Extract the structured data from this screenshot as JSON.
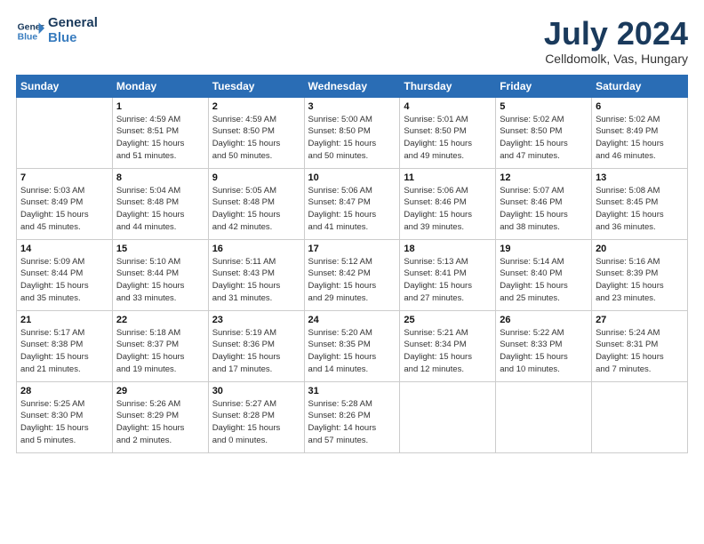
{
  "header": {
    "logo_line1": "General",
    "logo_line2": "Blue",
    "month": "July 2024",
    "location": "Celldomolk, Vas, Hungary"
  },
  "weekdays": [
    "Sunday",
    "Monday",
    "Tuesday",
    "Wednesday",
    "Thursday",
    "Friday",
    "Saturday"
  ],
  "weeks": [
    [
      {
        "day": "",
        "info": ""
      },
      {
        "day": "1",
        "info": "Sunrise: 4:59 AM\nSunset: 8:51 PM\nDaylight: 15 hours\nand 51 minutes."
      },
      {
        "day": "2",
        "info": "Sunrise: 4:59 AM\nSunset: 8:50 PM\nDaylight: 15 hours\nand 50 minutes."
      },
      {
        "day": "3",
        "info": "Sunrise: 5:00 AM\nSunset: 8:50 PM\nDaylight: 15 hours\nand 50 minutes."
      },
      {
        "day": "4",
        "info": "Sunrise: 5:01 AM\nSunset: 8:50 PM\nDaylight: 15 hours\nand 49 minutes."
      },
      {
        "day": "5",
        "info": "Sunrise: 5:02 AM\nSunset: 8:50 PM\nDaylight: 15 hours\nand 47 minutes."
      },
      {
        "day": "6",
        "info": "Sunrise: 5:02 AM\nSunset: 8:49 PM\nDaylight: 15 hours\nand 46 minutes."
      }
    ],
    [
      {
        "day": "7",
        "info": "Sunrise: 5:03 AM\nSunset: 8:49 PM\nDaylight: 15 hours\nand 45 minutes."
      },
      {
        "day": "8",
        "info": "Sunrise: 5:04 AM\nSunset: 8:48 PM\nDaylight: 15 hours\nand 44 minutes."
      },
      {
        "day": "9",
        "info": "Sunrise: 5:05 AM\nSunset: 8:48 PM\nDaylight: 15 hours\nand 42 minutes."
      },
      {
        "day": "10",
        "info": "Sunrise: 5:06 AM\nSunset: 8:47 PM\nDaylight: 15 hours\nand 41 minutes."
      },
      {
        "day": "11",
        "info": "Sunrise: 5:06 AM\nSunset: 8:46 PM\nDaylight: 15 hours\nand 39 minutes."
      },
      {
        "day": "12",
        "info": "Sunrise: 5:07 AM\nSunset: 8:46 PM\nDaylight: 15 hours\nand 38 minutes."
      },
      {
        "day": "13",
        "info": "Sunrise: 5:08 AM\nSunset: 8:45 PM\nDaylight: 15 hours\nand 36 minutes."
      }
    ],
    [
      {
        "day": "14",
        "info": "Sunrise: 5:09 AM\nSunset: 8:44 PM\nDaylight: 15 hours\nand 35 minutes."
      },
      {
        "day": "15",
        "info": "Sunrise: 5:10 AM\nSunset: 8:44 PM\nDaylight: 15 hours\nand 33 minutes."
      },
      {
        "day": "16",
        "info": "Sunrise: 5:11 AM\nSunset: 8:43 PM\nDaylight: 15 hours\nand 31 minutes."
      },
      {
        "day": "17",
        "info": "Sunrise: 5:12 AM\nSunset: 8:42 PM\nDaylight: 15 hours\nand 29 minutes."
      },
      {
        "day": "18",
        "info": "Sunrise: 5:13 AM\nSunset: 8:41 PM\nDaylight: 15 hours\nand 27 minutes."
      },
      {
        "day": "19",
        "info": "Sunrise: 5:14 AM\nSunset: 8:40 PM\nDaylight: 15 hours\nand 25 minutes."
      },
      {
        "day": "20",
        "info": "Sunrise: 5:16 AM\nSunset: 8:39 PM\nDaylight: 15 hours\nand 23 minutes."
      }
    ],
    [
      {
        "day": "21",
        "info": "Sunrise: 5:17 AM\nSunset: 8:38 PM\nDaylight: 15 hours\nand 21 minutes."
      },
      {
        "day": "22",
        "info": "Sunrise: 5:18 AM\nSunset: 8:37 PM\nDaylight: 15 hours\nand 19 minutes."
      },
      {
        "day": "23",
        "info": "Sunrise: 5:19 AM\nSunset: 8:36 PM\nDaylight: 15 hours\nand 17 minutes."
      },
      {
        "day": "24",
        "info": "Sunrise: 5:20 AM\nSunset: 8:35 PM\nDaylight: 15 hours\nand 14 minutes."
      },
      {
        "day": "25",
        "info": "Sunrise: 5:21 AM\nSunset: 8:34 PM\nDaylight: 15 hours\nand 12 minutes."
      },
      {
        "day": "26",
        "info": "Sunrise: 5:22 AM\nSunset: 8:33 PM\nDaylight: 15 hours\nand 10 minutes."
      },
      {
        "day": "27",
        "info": "Sunrise: 5:24 AM\nSunset: 8:31 PM\nDaylight: 15 hours\nand 7 minutes."
      }
    ],
    [
      {
        "day": "28",
        "info": "Sunrise: 5:25 AM\nSunset: 8:30 PM\nDaylight: 15 hours\nand 5 minutes."
      },
      {
        "day": "29",
        "info": "Sunrise: 5:26 AM\nSunset: 8:29 PM\nDaylight: 15 hours\nand 2 minutes."
      },
      {
        "day": "30",
        "info": "Sunrise: 5:27 AM\nSunset: 8:28 PM\nDaylight: 15 hours\nand 0 minutes."
      },
      {
        "day": "31",
        "info": "Sunrise: 5:28 AM\nSunset: 8:26 PM\nDaylight: 14 hours\nand 57 minutes."
      },
      {
        "day": "",
        "info": ""
      },
      {
        "day": "",
        "info": ""
      },
      {
        "day": "",
        "info": ""
      }
    ]
  ]
}
